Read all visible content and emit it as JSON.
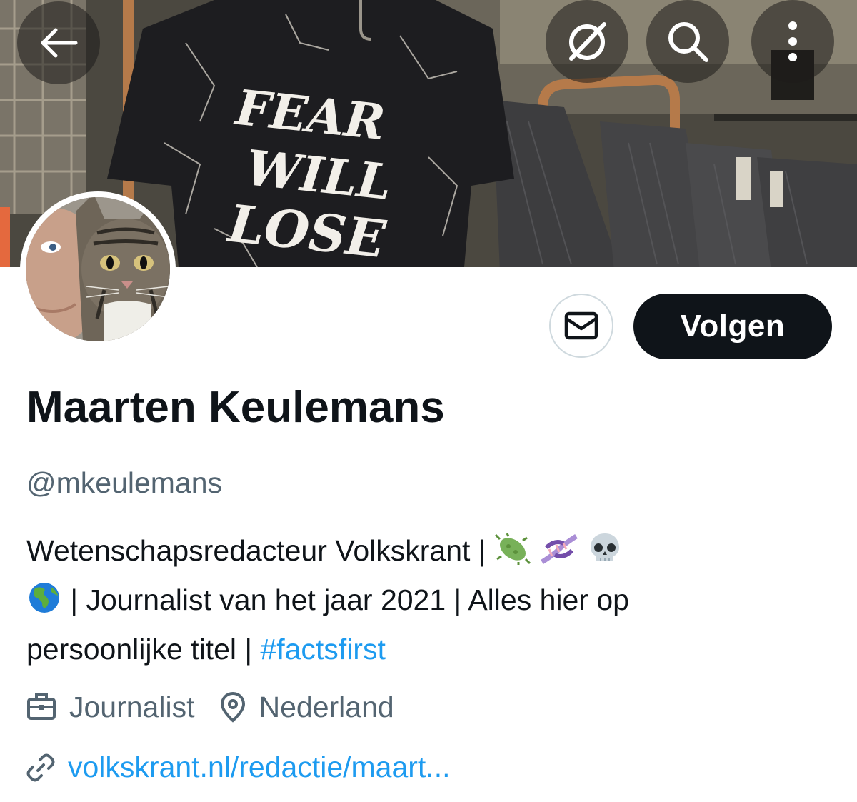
{
  "header": {
    "back_icon": "arrow-left-icon",
    "grok_icon": "grok-slash-circle-icon",
    "search_icon": "search-icon",
    "more_icon": "more-vertical-icon"
  },
  "banner": {
    "shirt_text": [
      "FEAR",
      "WILL",
      "LOSE"
    ]
  },
  "actions": {
    "message_icon": "envelope-icon",
    "follow_label": "Volgen"
  },
  "profile": {
    "name": "Maarten Keulemans",
    "handle": "@mkeulemans",
    "bio": {
      "line1_text": "Wetenschapsredacteur Volkskrant | ",
      "line1_emojis": [
        "microbe",
        "dna",
        "skull"
      ],
      "line2_emoji": "globe-americas",
      "line2_text": " | Journalist van het jaar 2021 | Alles hier op",
      "line3_text": "persoonlijke titel | ",
      "hashtag": "#factsfirst"
    },
    "profession": "Journalist",
    "location": "Nederland",
    "website": "volkskrant.nl/redactie/maart..."
  },
  "colors": {
    "text_primary": "#0f1419",
    "text_secondary": "#536471",
    "link": "#1d9bf0",
    "follow_bg": "#0f1419",
    "border": "#cfd9de"
  }
}
